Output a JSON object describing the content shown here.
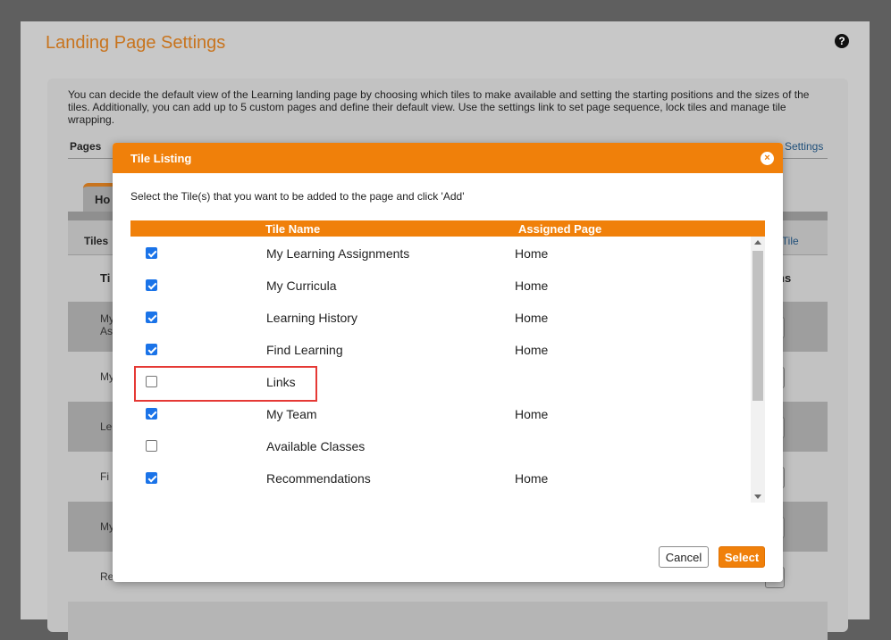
{
  "background_page": {
    "title": "Landing Page Settings",
    "help_icon": "?",
    "intro": "You can decide the default view of the Learning landing page by choosing which tiles to make available and setting the starting positions and the sizes of the tiles. Additionally, you can add up to 5 custom pages and define their default view. Use the settings link to set page sequence, lock tiles and manage tile wrapping.",
    "pages_label": "Pages",
    "settings_link": "Settings",
    "home_tab_partial": "Ho",
    "tiles_label": "Tiles",
    "add_tile_partial": "l Tile",
    "header_tile_partial": "Ti",
    "header_actions_partial": "ns",
    "row_labels_partial": [
      "My\nAs",
      "My",
      "Le",
      "Fi",
      "My",
      "Re"
    ]
  },
  "modal": {
    "title": "Tile Listing",
    "close_icon": "×",
    "instruction": "Select the Tile(s) that you want to be added to the page and click 'Add'",
    "columns": {
      "tile_name": "Tile Name",
      "assigned_page": "Assigned Page"
    },
    "tiles": [
      {
        "name": "My Learning Assignments",
        "page": "Home",
        "checked": true
      },
      {
        "name": "My Curricula",
        "page": "Home",
        "checked": true
      },
      {
        "name": "Learning History",
        "page": "Home",
        "checked": true
      },
      {
        "name": "Find Learning",
        "page": "Home",
        "checked": true
      },
      {
        "name": "Links",
        "page": "",
        "checked": false
      },
      {
        "name": "My Team",
        "page": "Home",
        "checked": true
      },
      {
        "name": "Available Classes",
        "page": "",
        "checked": false
      },
      {
        "name": "Recommendations",
        "page": "Home",
        "checked": true
      }
    ],
    "buttons": {
      "cancel": "Cancel",
      "select": "Select"
    }
  },
  "colors": {
    "accent": "#f0800a",
    "title_orange": "#c8741e",
    "checkbox_blue": "#1a73e8",
    "highlight_red": "#e53935"
  }
}
